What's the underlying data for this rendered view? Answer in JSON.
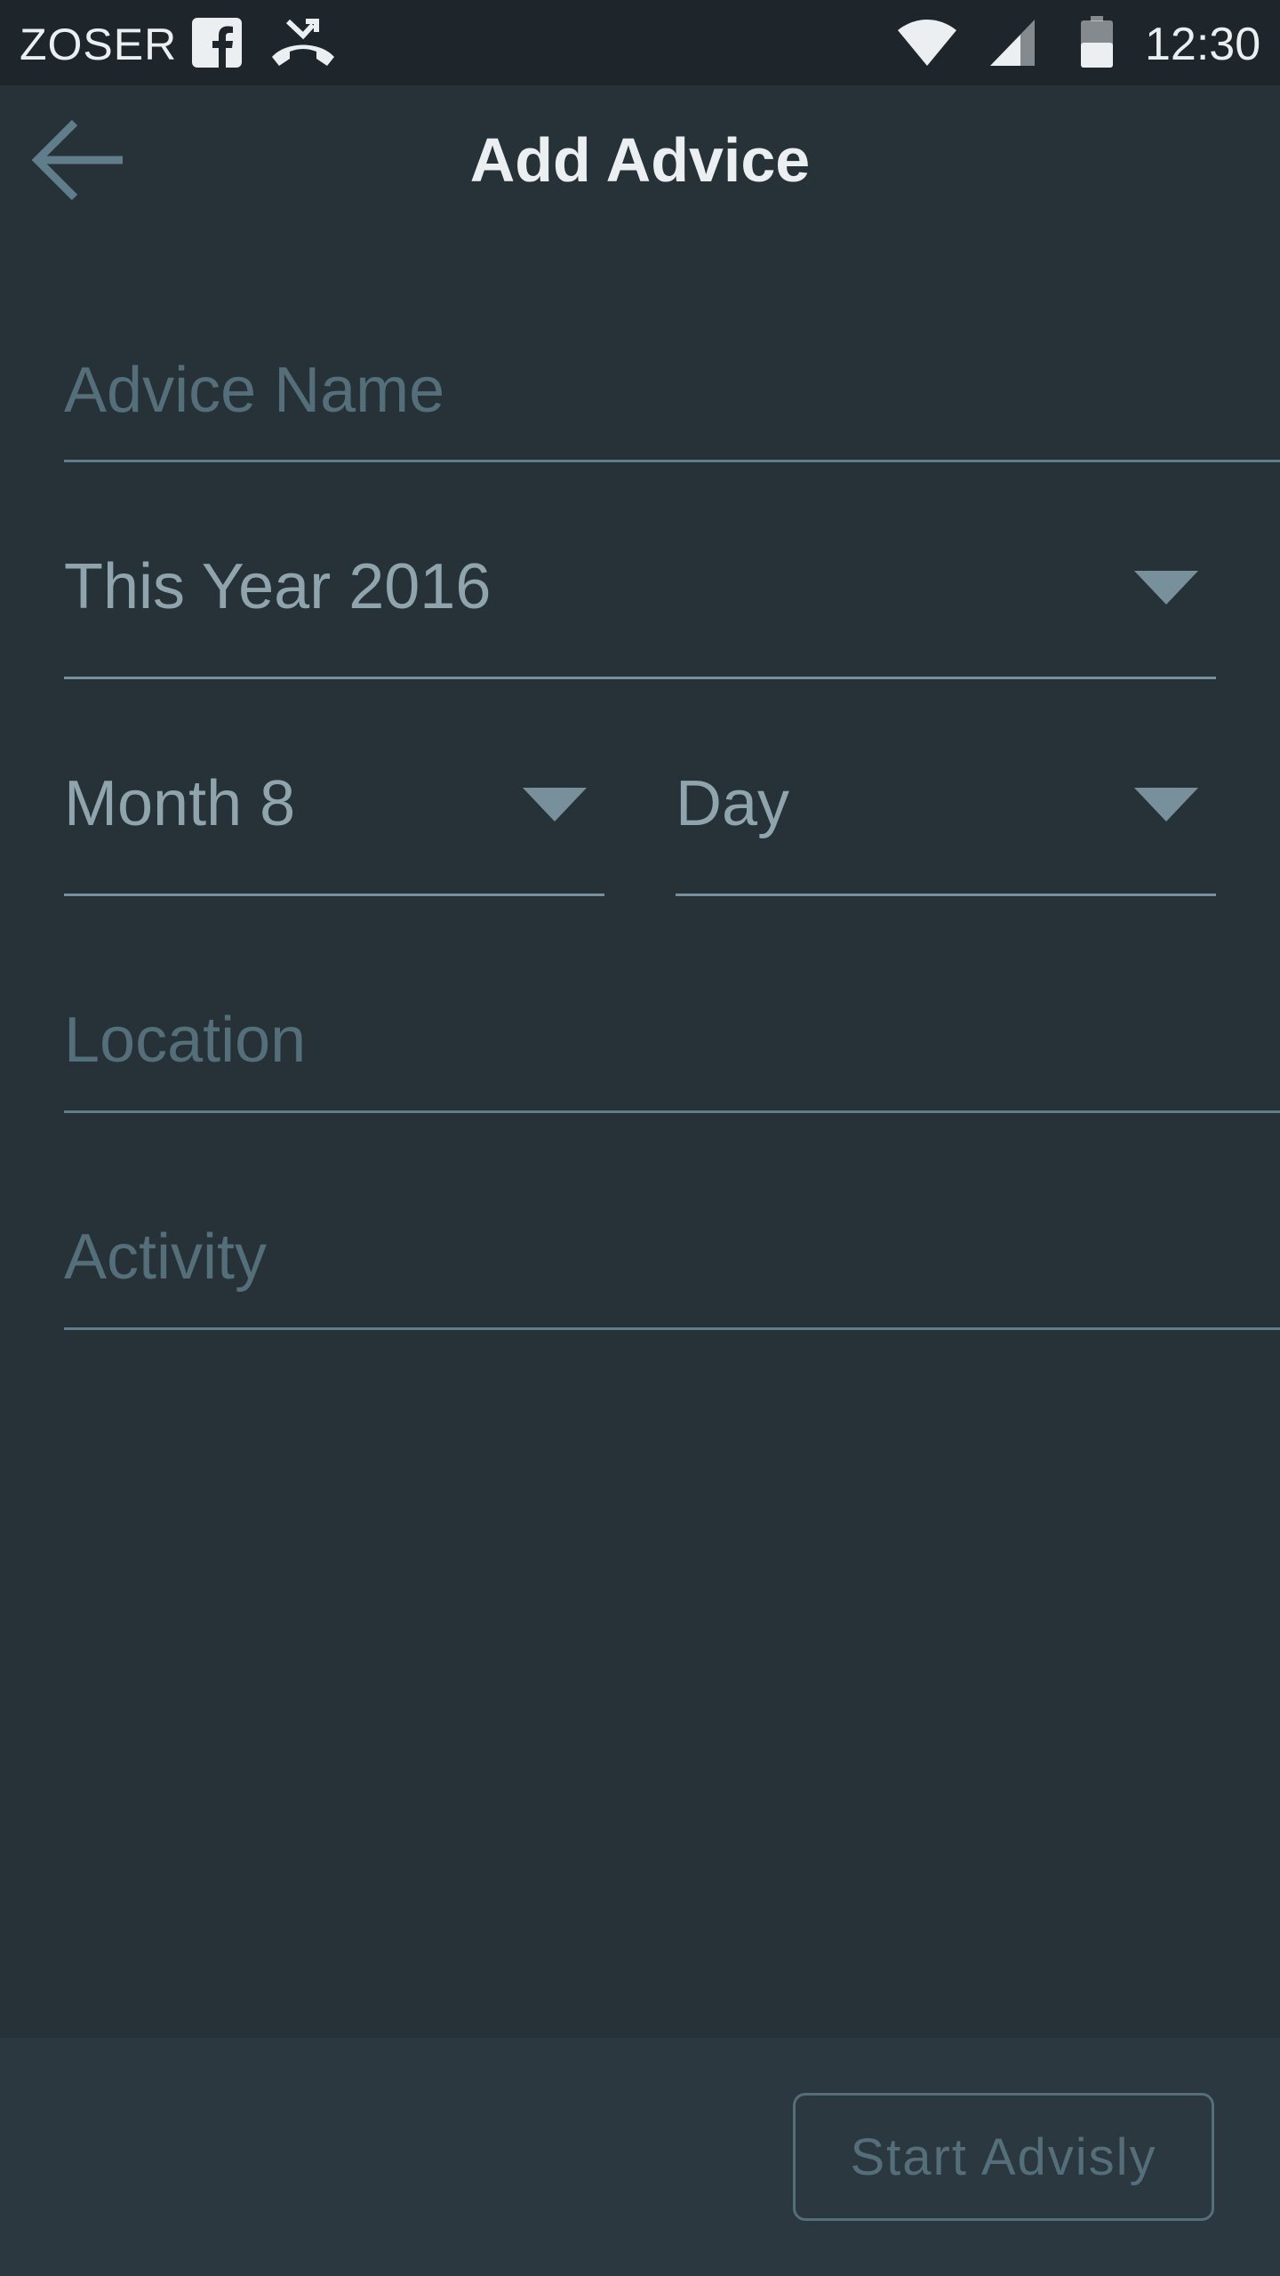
{
  "status_bar": {
    "carrier": "ZOSER",
    "time": "12:30",
    "icons": [
      "facebook-icon",
      "missed-call-icon",
      "wifi-icon",
      "signal-icon",
      "battery-icon"
    ]
  },
  "app_bar": {
    "title": "Add Advice",
    "back_icon": "arrow-left-icon"
  },
  "form": {
    "advice_name": {
      "placeholder": "Advice Name",
      "value": ""
    },
    "year": {
      "selected": "This Year 2016"
    },
    "month": {
      "selected": "Month 8"
    },
    "day": {
      "selected": "Day"
    },
    "location": {
      "placeholder": "Location",
      "value": ""
    },
    "activity": {
      "placeholder": "Activity",
      "value": ""
    }
  },
  "footer": {
    "start_label": "Start Advisly"
  },
  "colors": {
    "background": "#263238",
    "status_bar": "#1e252b",
    "footer": "#2b3840",
    "text_primary": "#eceff1",
    "text_muted": "#90a4ae",
    "placeholder": "#546e7a",
    "divider": "#607d8b"
  }
}
